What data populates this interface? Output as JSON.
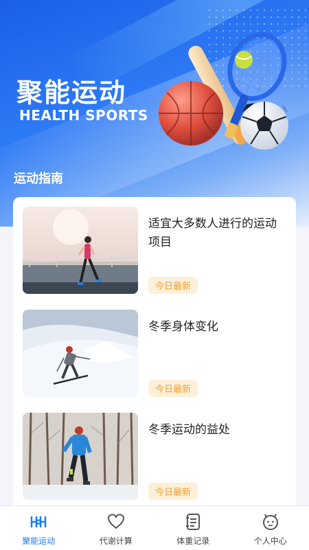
{
  "hero": {
    "title": "聚能运动",
    "subtitle": "HEALTH SPORTS"
  },
  "section": {
    "title": "运动指南"
  },
  "articles": [
    {
      "title": "适宜大多数人进行的运动项目",
      "badge": "今日最新",
      "image": "woman-running-on-road"
    },
    {
      "title": "冬季身体变化",
      "badge": "今日最新",
      "image": "skier-in-snow"
    },
    {
      "title": "冬季运动的益处",
      "badge": "今日最新",
      "image": "runner-in-snowy-forest"
    }
  ],
  "tabbar": {
    "items": [
      {
        "label": "聚能运动",
        "icon": "sports-home-icon",
        "active": true
      },
      {
        "label": "代谢计算",
        "icon": "heart-icon",
        "active": false
      },
      {
        "label": "体重记录",
        "icon": "notebook-icon",
        "active": false
      },
      {
        "label": "个人中心",
        "icon": "face-icon",
        "active": false
      }
    ]
  },
  "colors": {
    "accent": "#1e7bf0",
    "badge_text": "#f0a030",
    "badge_bg": "#fdf0d9"
  }
}
